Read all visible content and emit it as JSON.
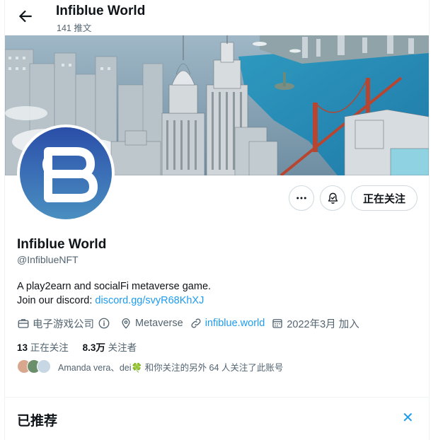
{
  "header": {
    "title": "Infiblue World",
    "post_count": "141 推文"
  },
  "profile": {
    "name": "Infiblue World",
    "handle": "@InfiblueNFT",
    "bio_line1": "A play2earn and socialFi metaverse game.",
    "bio_line2_prefix": "Join our discord: ",
    "bio_link": "discord.gg/svyR68KhXJ",
    "category": "电子游戏公司",
    "location": "Metaverse",
    "website": "infiblue.world",
    "joined": "2022年3月 加入",
    "following_count": "13",
    "following_label": " 正在关注",
    "followers_count": "8.3万",
    "followers_label": " 关注者",
    "followed_by_text": "Amanda vera、dei🍀 和你关注的另外 64 人关注了此账号"
  },
  "actions": {
    "follow_label": "正在关注",
    "more_icon": "more-icon",
    "notify_icon": "notification-bell-icon"
  },
  "suggestions": {
    "title": "已推荐",
    "close_icon": "close-icon"
  },
  "colors": {
    "accent": "#1d9bf0",
    "text": "#0f1419",
    "secondary": "#536471"
  }
}
